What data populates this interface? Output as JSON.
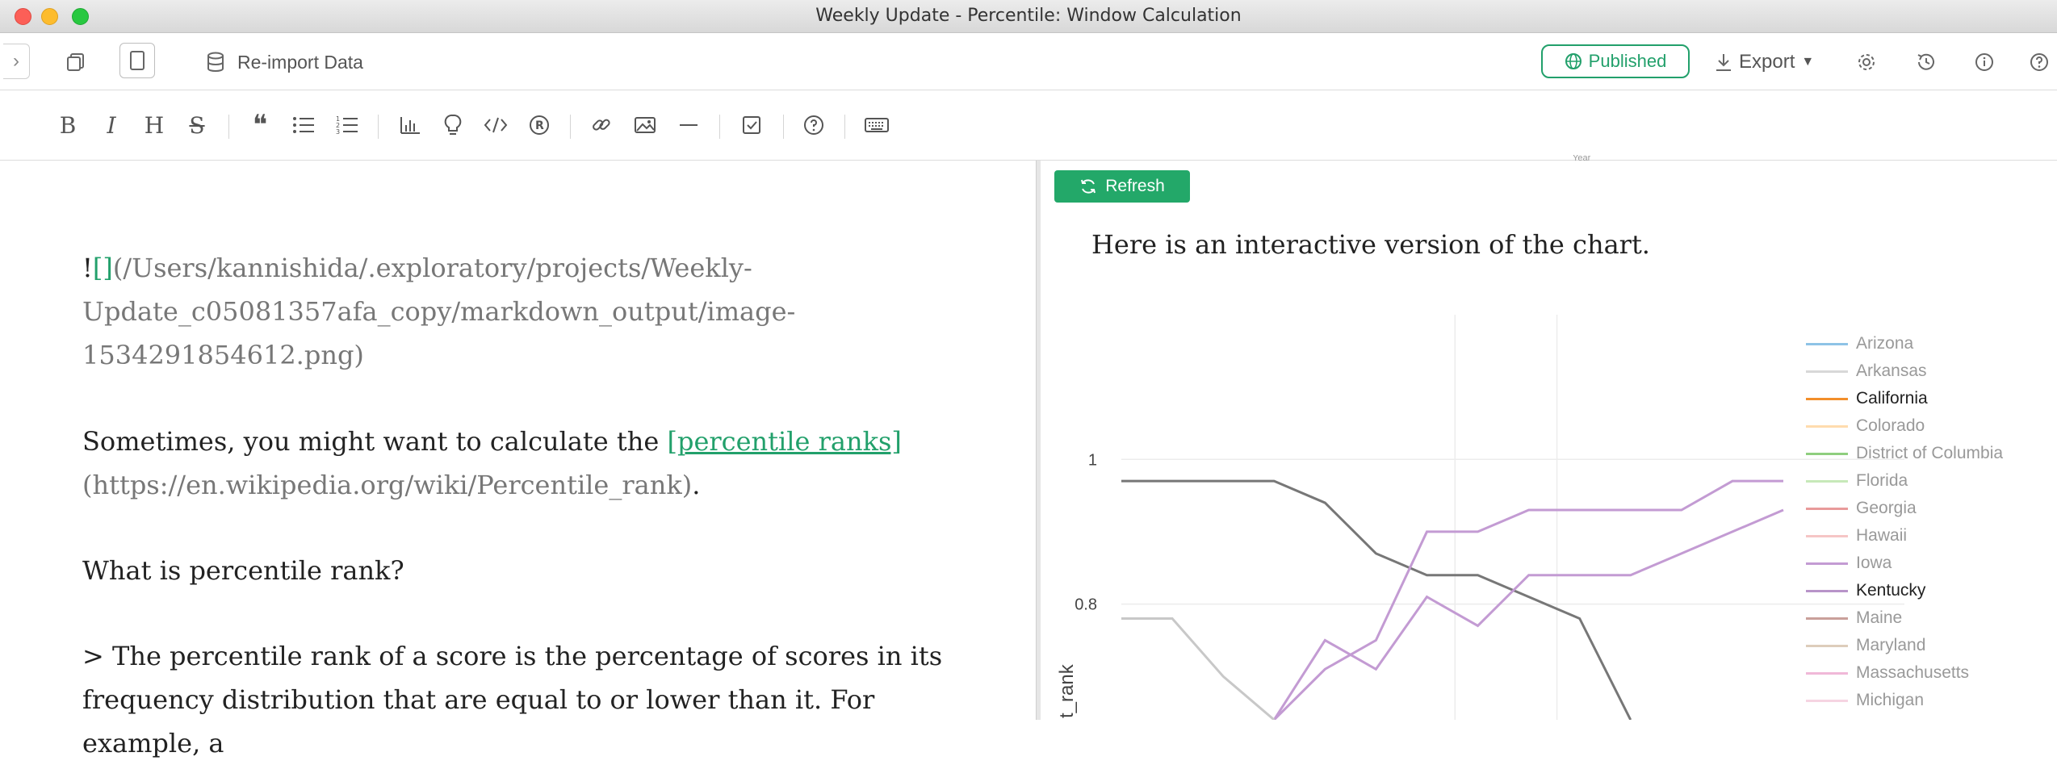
{
  "window": {
    "title": "Weekly Update - Percentile: Window Calculation"
  },
  "toolbar": {
    "reimport_label": "Re-import Data",
    "published_label": "Published",
    "export_label": "Export"
  },
  "editor": {
    "image_link_bang": "!",
    "image_link_brackets": "[]",
    "image_link_line1": "(/Users/kannishida/.exploratory/projects/Weekly-",
    "image_link_line2": "Update_c05081357afa_copy/markdown_output/image-",
    "image_link_line3": "1534291854612.png)",
    "para1_text": "Sometimes, you might want to calculate the ",
    "para1_link": "[percentile ranks]",
    "para1_url": "(https://en.wikipedia.org/wiki/Percentile_rank)",
    "para1_end": ".",
    "heading_question": "What is percentile rank?",
    "quote_line1": "> The percentile rank of a score is the percentage of scores in its",
    "quote_line2": "frequency distribution that are equal to or lower than it. For example, a"
  },
  "preview": {
    "refresh_label": "Refresh",
    "intro_text": "Here is an interactive version of the chart.",
    "top_axis_fragment": "Year"
  },
  "colors": {
    "accent": "#22a06b",
    "published_border": "#22a06b"
  },
  "chart_data": {
    "type": "line",
    "ylabel": "t_rank",
    "y_ticks": [
      "1",
      "0.8"
    ],
    "ylim": [
      0.64,
      1.2
    ],
    "x": [
      0,
      1,
      2,
      3,
      4,
      5,
      6,
      7,
      8,
      9,
      10,
      11,
      12,
      13
    ],
    "series": [
      {
        "name": "Kentucky",
        "color": "#777777",
        "values": [
          0.97,
          0.97,
          0.97,
          0.97,
          0.94,
          0.87,
          0.84,
          0.84,
          0.81,
          0.78,
          0.64,
          null,
          null,
          null
        ]
      },
      {
        "name": "",
        "color": "#c39bd3",
        "values": [
          null,
          null,
          null,
          0.64,
          0.71,
          0.75,
          0.9,
          0.9,
          0.93,
          0.93,
          0.93,
          0.93,
          0.97,
          0.97
        ]
      },
      {
        "name": "",
        "color": "#c39bd3",
        "values": [
          null,
          null,
          null,
          0.64,
          0.75,
          0.71,
          0.81,
          0.77,
          0.84,
          0.84,
          0.84,
          0.87,
          0.9,
          0.93
        ]
      },
      {
        "name": "",
        "color": "#c8c8c8",
        "values": [
          0.78,
          0.78,
          0.7,
          0.64,
          null,
          null,
          null,
          null,
          null,
          null,
          null,
          null,
          null,
          null
        ]
      }
    ],
    "legend": [
      {
        "name": "Arizona",
        "color": "#8ec3e6",
        "active": false
      },
      {
        "name": "Arkansas",
        "color": "#d8d8d8",
        "active": false
      },
      {
        "name": "California",
        "color": "#f28e2b",
        "active": true
      },
      {
        "name": "Colorado",
        "color": "#ffdcae",
        "active": false
      },
      {
        "name": "District of Columbia",
        "color": "#8fce7f",
        "active": false
      },
      {
        "name": "Florida",
        "color": "#c7e9b9",
        "active": false
      },
      {
        "name": "Georgia",
        "color": "#e89a9a",
        "active": false
      },
      {
        "name": "Hawaii",
        "color": "#f6c6c6",
        "active": false
      },
      {
        "name": "Iowa",
        "color": "#c39bd3",
        "active": false
      },
      {
        "name": "Kentucky",
        "color": "#b894c9",
        "active": true
      },
      {
        "name": "Maine",
        "color": "#c9a09a",
        "active": false
      },
      {
        "name": "Maryland",
        "color": "#ddcdbb",
        "active": false
      },
      {
        "name": "Massachusetts",
        "color": "#f0b8d8",
        "active": false
      },
      {
        "name": "Michigan",
        "color": "#f6d4e2",
        "active": false
      }
    ],
    "legend_position": "right"
  }
}
